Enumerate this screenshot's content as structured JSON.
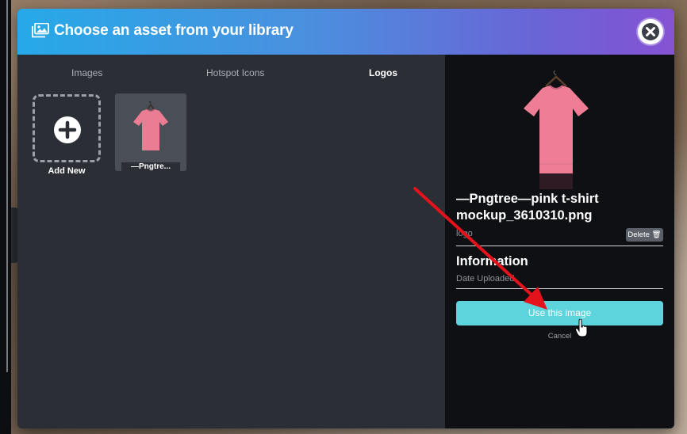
{
  "modal": {
    "title": "Choose an asset from your library",
    "header_icon": "image-gallery-icon",
    "close_icon": "close-icon"
  },
  "tabs": [
    {
      "label": "Images",
      "active": false
    },
    {
      "label": "Hotspot Icons",
      "active": false
    },
    {
      "label": "Logos",
      "active": true
    }
  ],
  "library": {
    "add_new_label": "Add New",
    "add_icon": "plus-circle-icon",
    "items": [
      {
        "label": "—Pngtre...",
        "thumb_icon": "pink-tshirt-image"
      }
    ]
  },
  "details": {
    "file_name": "—Pngtree—pink t-shirt mockup_3610310.png",
    "file_type": "logo",
    "delete_label": "Delete",
    "delete_icon": "trash-icon",
    "info_heading": "Information",
    "date_uploaded": "Date Uploaded",
    "use_button": "Use this image",
    "cancel_label": "Cancel"
  },
  "colors": {
    "header_gradient_start": "#26a9e8",
    "header_gradient_end": "#8553d3",
    "use_button": "#5dd3db",
    "annotation_arrow": "#e3121b"
  }
}
